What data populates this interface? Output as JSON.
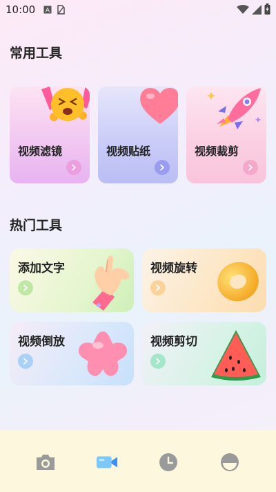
{
  "status": {
    "time": "10:00"
  },
  "common_tools": {
    "title": "常用工具",
    "items": [
      {
        "label": "视频滤镜",
        "icon": "shocked-emoji-icon"
      },
      {
        "label": "视频贴纸",
        "icon": "heart-icon"
      },
      {
        "label": "视频裁剪",
        "icon": "rocket-icon"
      }
    ]
  },
  "hot_tools": {
    "title": "热门工具",
    "items": [
      {
        "label": "添加文字",
        "icon": "hand-gesture-icon"
      },
      {
        "label": "视频旋转",
        "icon": "donut-ring-icon"
      },
      {
        "label": "视频倒放",
        "icon": "star-flower-icon"
      },
      {
        "label": "视频剪切",
        "icon": "watermelon-icon"
      }
    ]
  },
  "bottom_nav": {
    "items": [
      {
        "icon": "camera-icon",
        "active": false
      },
      {
        "icon": "video-icon",
        "active": true
      },
      {
        "icon": "clock-icon",
        "active": false
      },
      {
        "icon": "profile-icon",
        "active": false
      }
    ]
  }
}
